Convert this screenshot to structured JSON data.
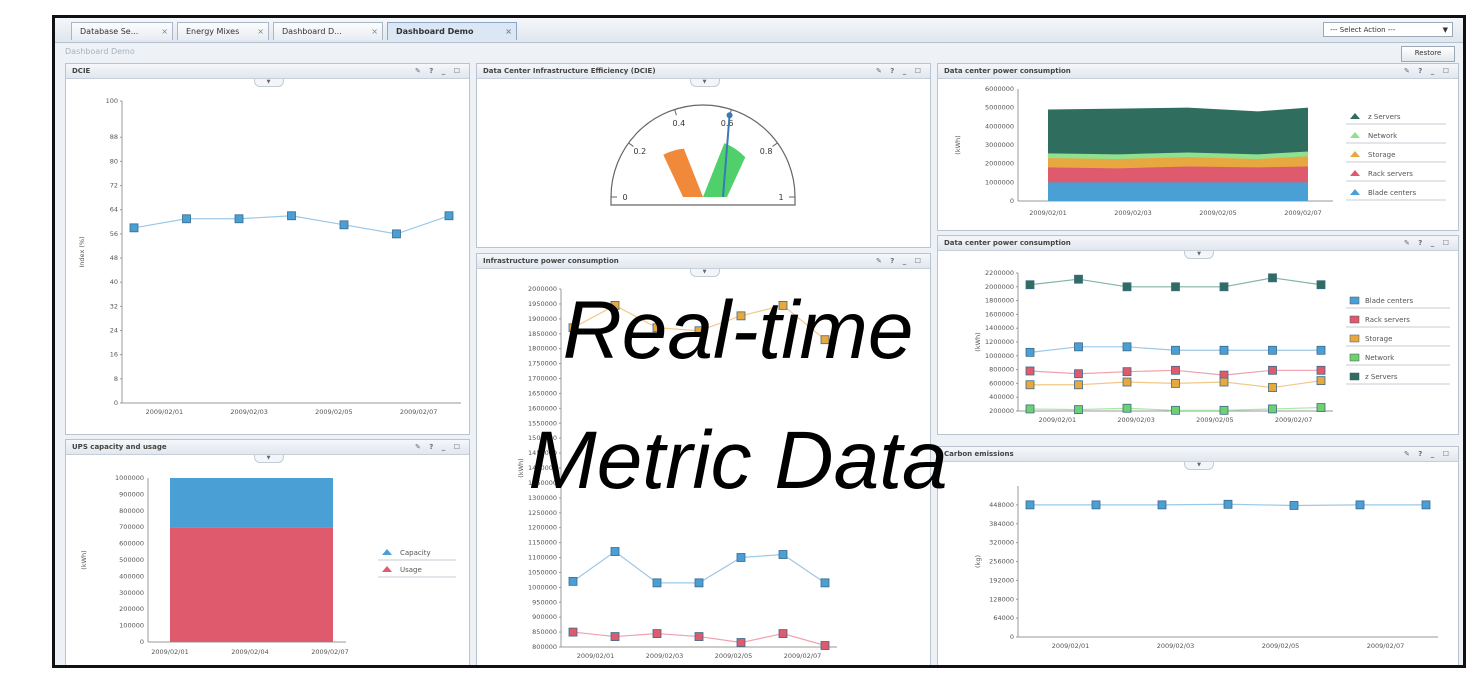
{
  "tabs": [
    "Database Se...",
    "Energy Mixes",
    "Dashboard D...",
    "Dashboard Demo"
  ],
  "action_select": "--- Select Action ---",
  "breadcrumb": "Dashboard Demo",
  "restore_label": "Restore",
  "panel_controls": "✎ ? _ ☐",
  "overlay": {
    "line1": "Real-time",
    "line2": "Metric Data"
  },
  "colors": {
    "blue": "#4a9fd4",
    "red": "#e05a6e",
    "orange": "#e8a840",
    "green": "#6fd06f",
    "teal": "#2f6e5e",
    "line_blue": "#9cc8e8",
    "line_red": "#f0a0ad",
    "line_orange": "#f2c98a"
  },
  "panels": {
    "dcie": "DCIE",
    "gauge": "Data Center Infrastructure Efficiency (DCIE)",
    "dc1": "Data center power consumption",
    "infra": "Infrastructure power consumption",
    "dc2": "Data center power consumption",
    "ups": "UPS capacity and usage",
    "co2": "Carbon emissions"
  },
  "chart_data": [
    {
      "id": "dcie",
      "type": "line",
      "x": [
        "2009/02/01",
        "2009/02/02",
        "2009/02/03",
        "2009/02/04",
        "2009/02/05",
        "2009/02/06",
        "2009/02/07"
      ],
      "xticks": [
        "2009/02/01",
        "2009/02/03",
        "2009/02/05",
        "2009/02/07"
      ],
      "ylabel": "Index (%)",
      "ylim": [
        0,
        100
      ],
      "yticks": [
        0,
        8,
        16,
        24,
        32,
        40,
        48,
        56,
        64,
        72,
        80,
        88,
        100
      ],
      "series": [
        {
          "values": [
            58,
            61,
            61,
            62,
            59,
            56,
            62
          ]
        }
      ]
    },
    {
      "id": "gauge",
      "type": "gauge",
      "ticks": [
        "0",
        "0.2",
        "0.4",
        "0.6",
        "0.8",
        "1"
      ],
      "value": 0.6
    },
    {
      "id": "dc1",
      "type": "area",
      "xticks": [
        "2009/02/01",
        "2009/02/03",
        "2009/02/05",
        "2009/02/07"
      ],
      "ylabel": "(kWh)",
      "ylim": [
        0,
        6000000
      ],
      "yticks": [
        "0",
        "1000000",
        "2000000",
        "3000000",
        "4000000",
        "5000000",
        "6000000"
      ],
      "legend": [
        "z Servers",
        "Network",
        "Storage",
        "Rack servers",
        "Blade centers"
      ]
    },
    {
      "id": "infra",
      "type": "line",
      "x": [
        "2009/02/01",
        "2009/02/02",
        "2009/02/03",
        "2009/02/04",
        "2009/02/05",
        "2009/02/06",
        "2009/02/07"
      ],
      "xticks": [
        "2009/02/01",
        "2009/02/03",
        "2009/02/05",
        "2009/02/07"
      ],
      "ylabel": "(kWh)",
      "ylim": [
        800000,
        2000000
      ],
      "yticks": [
        "800000",
        "850000",
        "900000",
        "950000",
        "1000000",
        "1050000",
        "1100000",
        "1150000",
        "1200000",
        "1250000",
        "1300000",
        "1350000",
        "1400000",
        "1450000",
        "1500000",
        "1550000",
        "1600000",
        "1650000",
        "1700000",
        "1750000",
        "1800000",
        "1850000",
        "1900000",
        "1950000",
        "2000000"
      ],
      "series": [
        {
          "color": "orange",
          "values": [
            1870000,
            1945000,
            1870000,
            1860000,
            1910000,
            1945000,
            1830000
          ]
        },
        {
          "color": "blue",
          "values": [
            1020000,
            1120000,
            1015000,
            1015000,
            1100000,
            1110000,
            1015000
          ]
        },
        {
          "color": "red",
          "values": [
            850000,
            835000,
            845000,
            835000,
            815000,
            845000,
            805000
          ]
        }
      ]
    },
    {
      "id": "dc2",
      "type": "line",
      "x": [
        "2009/02/01",
        "2009/02/02",
        "2009/02/03",
        "2009/02/04",
        "2009/02/05",
        "2009/02/06",
        "2009/02/07"
      ],
      "xticks": [
        "2009/02/01",
        "2009/02/03",
        "2009/02/05",
        "2009/02/07"
      ],
      "ylabel": "(kWh)",
      "ylim": [
        200000,
        2200000
      ],
      "yticks": [
        "200000",
        "400000",
        "600000",
        "800000",
        "1000000",
        "1200000",
        "1400000",
        "1600000",
        "1800000",
        "2000000",
        "2200000"
      ],
      "legend": [
        "Blade centers",
        "Rack servers",
        "Storage",
        "Network",
        "z Servers"
      ],
      "series": [
        {
          "name": "Blade centers",
          "color": "blue",
          "values": [
            1050000,
            1130000,
            1130000,
            1080000,
            1080000,
            1080000,
            1080000
          ]
        },
        {
          "name": "Rack servers",
          "color": "red",
          "values": [
            780000,
            740000,
            770000,
            790000,
            720000,
            790000,
            790000
          ]
        },
        {
          "name": "Storage",
          "color": "orange",
          "values": [
            580000,
            580000,
            620000,
            600000,
            620000,
            540000,
            640000
          ]
        },
        {
          "name": "Network",
          "color": "green",
          "values": [
            230000,
            220000,
            240000,
            210000,
            210000,
            230000,
            250000
          ]
        },
        {
          "name": "z Servers",
          "color": "teal",
          "values": [
            2030000,
            2110000,
            2000000,
            2000000,
            2000000,
            2130000,
            2030000
          ]
        }
      ]
    },
    {
      "id": "ups",
      "type": "bar",
      "categories": [
        "2009/02/01",
        "2009/02/04",
        "2009/02/07"
      ],
      "ylabel": "(kWh)",
      "ylim": [
        0,
        1000000
      ],
      "yticks": [
        "0",
        "100000",
        "200000",
        "300000",
        "400000",
        "500000",
        "600000",
        "700000",
        "800000",
        "900000",
        "1000000"
      ],
      "legend": [
        "Capacity",
        "Usage"
      ],
      "series": [
        {
          "name": "Capacity",
          "values": [
            1000000
          ]
        },
        {
          "name": "Usage",
          "values": [
            700000
          ]
        }
      ]
    },
    {
      "id": "co2",
      "type": "line",
      "x": [
        "2009/02/01",
        "2009/02/02",
        "2009/02/03",
        "2009/02/04",
        "2009/02/05",
        "2009/02/06",
        "2009/02/07"
      ],
      "xticks": [
        "2009/02/01",
        "2009/02/03",
        "2009/02/05",
        "2009/02/07"
      ],
      "ylabel": "(kg)",
      "ylim": [
        0,
        512000
      ],
      "yticks": [
        "0",
        "64000",
        "128000",
        "192000",
        "256000",
        "320000",
        "384000",
        "448000"
      ],
      "series": [
        {
          "values": [
            448000,
            448000,
            448000,
            450000,
            446000,
            448000,
            448000
          ]
        }
      ]
    }
  ]
}
